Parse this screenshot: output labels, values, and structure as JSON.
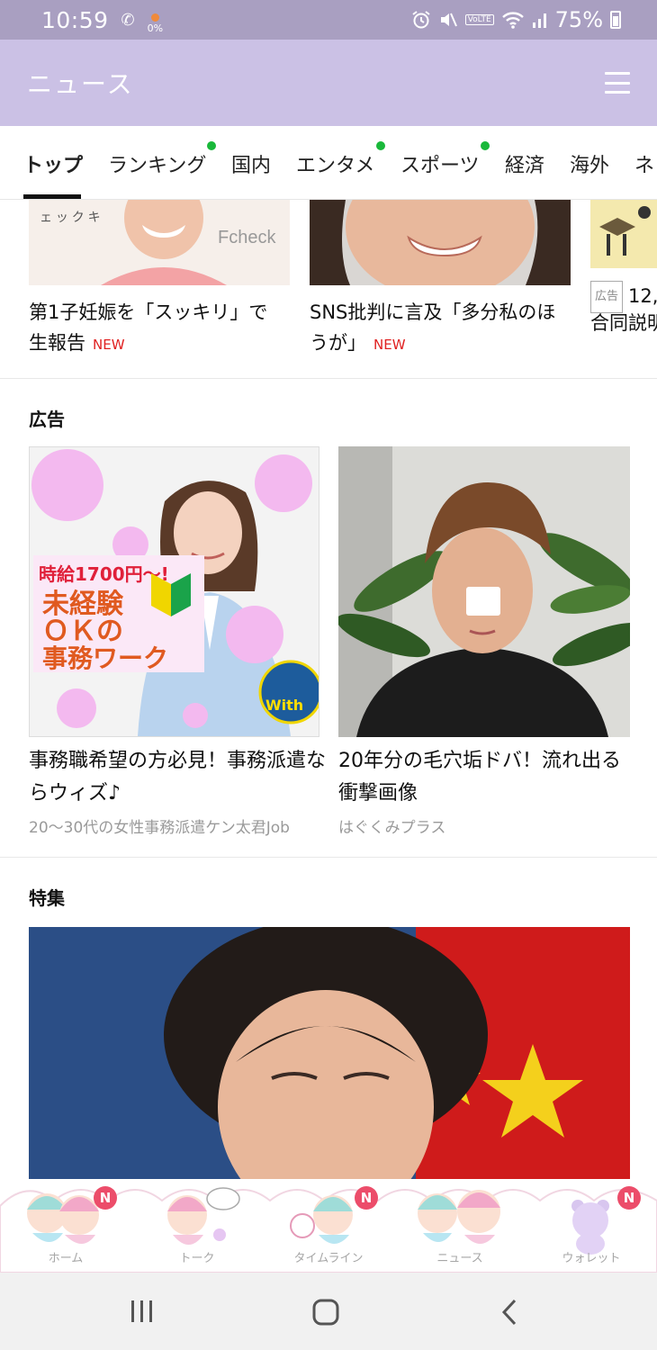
{
  "status_bar": {
    "time": "10:59",
    "data_indicator": "0%",
    "network": "VoLTE",
    "battery": "75%"
  },
  "header": {
    "title": "ニュース"
  },
  "tabs": [
    {
      "label": "トップ",
      "active": true,
      "dot": false
    },
    {
      "label": "ランキング",
      "active": false,
      "dot": true
    },
    {
      "label": "国内",
      "active": false,
      "dot": false
    },
    {
      "label": "エンタメ",
      "active": false,
      "dot": true
    },
    {
      "label": "スポーツ",
      "active": false,
      "dot": true
    },
    {
      "label": "経済",
      "active": false,
      "dot": false
    },
    {
      "label": "海外",
      "active": false,
      "dot": false
    },
    {
      "label": "ネ",
      "active": false,
      "dot": false
    }
  ],
  "top_articles": [
    {
      "title_line1": "第1子妊娠を「スッキリ」で",
      "title_line2": "生報告",
      "badge": "NEW",
      "thumb_text": "Fcheck",
      "thumb_sub": "ェ ッ ク キ"
    },
    {
      "title_line1": "SNS批判に言及「多分私のほ",
      "title_line2": "うが」",
      "badge": "NEW"
    },
    {
      "tag": "広告",
      "title_line1": "12,",
      "title_line2": "合同説明"
    }
  ],
  "ads_section": {
    "title": "広告",
    "cards": [
      {
        "title": "事務職希望の方必見！事務派遣ならウィズ♪",
        "source": "20〜30代の女性事務派遣ケン太君Job",
        "image_text": {
          "wage": "時給1700円〜!",
          "line1": "未経験",
          "line2": "ＯＫの",
          "line3": "事務ワーク",
          "brand": "With"
        }
      },
      {
        "title": "20年分の毛穴垢ドバ！流れ出る衝撃画像",
        "source": "はぐくみプラス"
      }
    ]
  },
  "feature_section": {
    "title": "特集"
  },
  "bottom_nav": [
    {
      "label": "ホーム",
      "badge": "N"
    },
    {
      "label": "トーク",
      "badge": ""
    },
    {
      "label": "タイムライン",
      "badge": "N"
    },
    {
      "label": "ニュース",
      "badge": ""
    },
    {
      "label": "ウォレット",
      "badge": "N"
    }
  ],
  "colors": {
    "header": "#cbc1e5",
    "status_bar": "#a99fc1",
    "dot": "#19b83a",
    "new": "#e02020",
    "badge": "#ec4d6a"
  }
}
